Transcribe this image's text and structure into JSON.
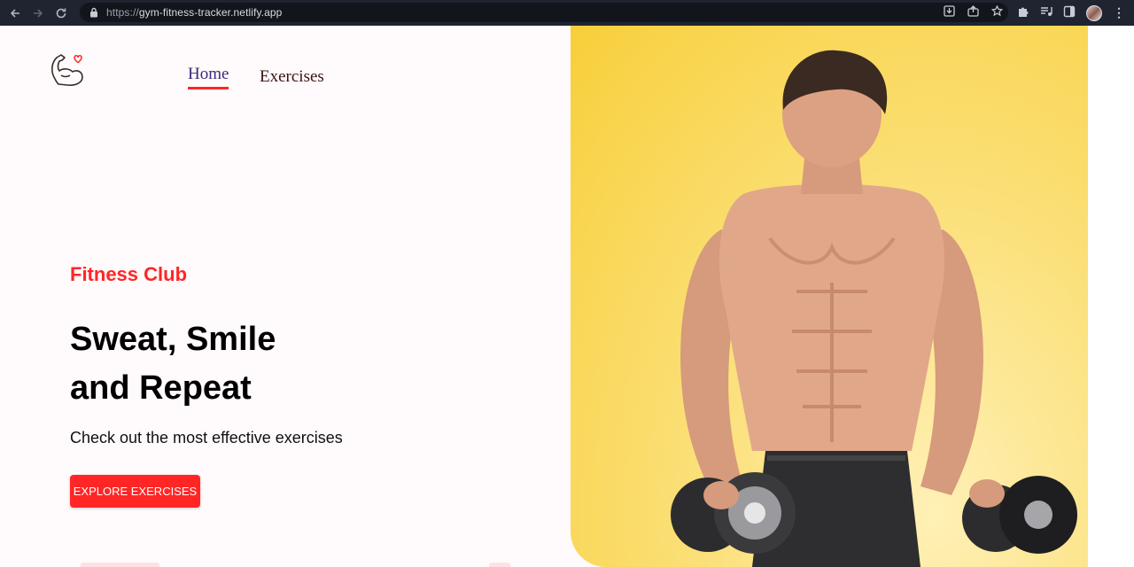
{
  "browser": {
    "url_scheme": "https://",
    "url_host": "gym-fitness-tracker.netlify.app",
    "icons": [
      "back-arrow-icon",
      "forward-arrow-icon",
      "reload-icon",
      "lock-icon",
      "install-icon",
      "share-icon",
      "star-icon",
      "puzzle-icon",
      "media-control-icon",
      "side-panel-icon",
      "menu-icon"
    ]
  },
  "nav": {
    "logo_icon": "flexed-arm-heart-icon",
    "links": [
      {
        "label": "Home",
        "active": true
      },
      {
        "label": "Exercises",
        "active": false
      }
    ]
  },
  "hero": {
    "subtitle": "Fitness Club",
    "title_line1": "Sweat, Smile",
    "title_line2": "and Repeat",
    "description": "Check out the most effective exercises",
    "button_label": "EXPLORE EXERCISES"
  },
  "banner": {
    "image": "muscular-man-with-dumbbells-photo",
    "background": "#f9d13f"
  },
  "colors": {
    "accent": "#ff2625",
    "page_bg": "#fffafb",
    "chrome_bg": "#1f2430"
  }
}
